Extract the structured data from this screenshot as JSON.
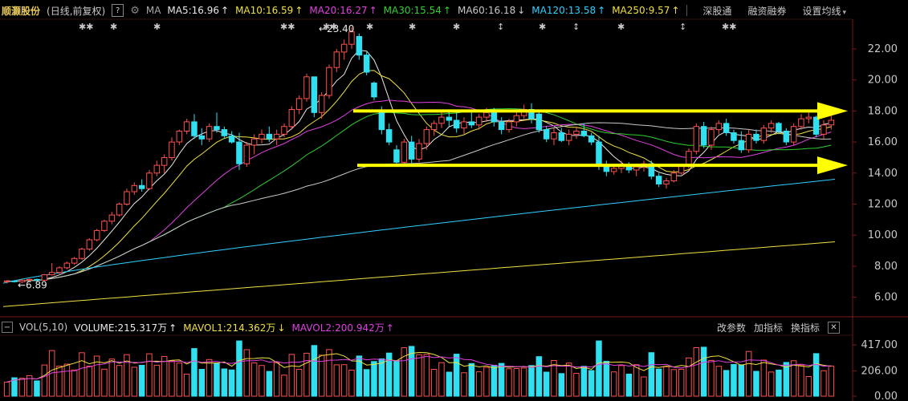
{
  "header": {
    "stock_name": "顺灏股份",
    "period_label": "(日线,前复权)",
    "help_button": "?",
    "ma_label": "MA",
    "ma": [
      {
        "label": "MA5:16.96",
        "trend": "↑",
        "color": "#e8e8e8"
      },
      {
        "label": "MA10:16.59",
        "trend": "↑",
        "color": "#f0e040"
      },
      {
        "label": "MA20:16.27",
        "trend": "↑",
        "color": "#e040e0"
      },
      {
        "label": "MA30:15.54",
        "trend": "↑",
        "color": "#30d030"
      },
      {
        "label": "MA60:16.18",
        "trend": "↓",
        "color": "#c8c8c8"
      },
      {
        "label": "MA120:13.58",
        "trend": "↑",
        "color": "#30d0ff"
      },
      {
        "label": "MA250:9.57",
        "trend": "↑",
        "color": "#f0e040"
      }
    ],
    "menu": {
      "shenzhen_connect": "深股通",
      "margin_trading": "融资融券",
      "settings_ma": "设置均线"
    }
  },
  "markers": {
    "symbols": [
      "✱✱",
      "✱",
      "✱",
      "✱✱",
      "✱✱",
      "✱",
      "✱",
      "✱",
      "↕",
      "✱",
      "↕",
      "✱",
      "↕",
      "✱✱"
    ]
  },
  "price_axis": {
    "ticks": [
      "22.00",
      "20.00",
      "18.00",
      "16.00",
      "14.00",
      "12.00",
      "10.00",
      "8.00",
      "6.00"
    ]
  },
  "annotations": {
    "high": "23.40",
    "low": "6.89"
  },
  "volume_panel": {
    "collapse_button": "−",
    "title": "VOL(5,10)",
    "volume": "VOLUME:215.317万",
    "volume_trend": "↑",
    "mavol1": "MAVOL1:214.362万",
    "mavol1_trend": "↓",
    "mavol2": "MAVOL2:200.942万",
    "mavol2_trend": "↑",
    "tools": {
      "edit_params": "改参数",
      "add_indicator": "加指标",
      "switch_indicator": "换指标",
      "close": "✕"
    },
    "axis_ticks": [
      "417.00",
      "206.00",
      "0.00"
    ]
  },
  "colors": {
    "up": "#ff5050",
    "down": "#30e0f0",
    "ma5": "#e8e8e8",
    "ma10": "#f0e040",
    "ma20": "#e040e0",
    "ma30": "#30d030",
    "ma60": "#c8c8c8",
    "ma120": "#30d0ff",
    "ma250": "#f0e040",
    "trendline": "#ffff00"
  },
  "chart_data": {
    "type": "candlestick",
    "ylim": [
      5.0,
      23.6
    ],
    "price_ticks": [
      22,
      20,
      18,
      16,
      14,
      12,
      10,
      8,
      6
    ],
    "annotated_high": 23.4,
    "annotated_low": 6.89,
    "horizontal_levels": [
      18.0,
      14.5
    ],
    "candles": [
      [
        7.0,
        7.1,
        6.9,
        7.05
      ],
      [
        7.05,
        7.1,
        6.95,
        7.0
      ],
      [
        7.0,
        7.15,
        6.9,
        7.1
      ],
      [
        7.1,
        7.2,
        7.0,
        7.15
      ],
      [
        7.15,
        7.2,
        7.05,
        7.1
      ],
      [
        7.1,
        7.5,
        7.05,
        7.45
      ],
      [
        7.45,
        8.2,
        7.4,
        7.6
      ],
      [
        7.6,
        8.0,
        7.5,
        7.9
      ],
      [
        7.9,
        8.3,
        7.8,
        8.2
      ],
      [
        8.2,
        8.6,
        8.1,
        8.5
      ],
      [
        8.5,
        9.2,
        8.4,
        9.1
      ],
      [
        9.1,
        9.8,
        9.0,
        9.7
      ],
      [
        9.7,
        10.4,
        9.6,
        10.3
      ],
      [
        10.3,
        11.0,
        10.2,
        10.9
      ],
      [
        10.9,
        11.5,
        10.7,
        11.3
      ],
      [
        11.3,
        12.1,
        11.2,
        12.0
      ],
      [
        12.0,
        13.0,
        11.9,
        12.8
      ],
      [
        12.8,
        13.4,
        12.6,
        13.2
      ],
      [
        13.2,
        13.6,
        12.8,
        13.0
      ],
      [
        13.0,
        14.2,
        12.9,
        14.0
      ],
      [
        14.0,
        14.8,
        13.8,
        14.5
      ],
      [
        14.5,
        15.2,
        14.0,
        15.0
      ],
      [
        15.0,
        16.3,
        14.8,
        16.0
      ],
      [
        16.0,
        16.8,
        15.8,
        16.7
      ],
      [
        16.7,
        17.5,
        16.5,
        17.3
      ],
      [
        17.3,
        17.8,
        16.2,
        16.4
      ],
      [
        16.4,
        16.9,
        15.8,
        16.2
      ],
      [
        16.2,
        17.2,
        16.0,
        17.0
      ],
      [
        17.0,
        17.9,
        16.6,
        16.8
      ],
      [
        16.8,
        17.0,
        16.2,
        16.4
      ],
      [
        16.4,
        16.7,
        15.9,
        16.0
      ],
      [
        16.0,
        16.6,
        14.2,
        14.6
      ],
      [
        14.6,
        16.0,
        14.4,
        15.8
      ],
      [
        15.8,
        16.5,
        15.2,
        16.2
      ],
      [
        16.2,
        16.8,
        15.9,
        16.5
      ],
      [
        16.5,
        17.0,
        16.0,
        16.2
      ],
      [
        16.2,
        16.8,
        15.8,
        16.5
      ],
      [
        16.5,
        17.2,
        16.3,
        17.0
      ],
      [
        17.0,
        18.3,
        16.8,
        18.1
      ],
      [
        18.1,
        19.0,
        17.8,
        18.8
      ],
      [
        18.8,
        20.4,
        18.6,
        20.2
      ],
      [
        20.2,
        19.9,
        17.6,
        17.9
      ],
      [
        17.9,
        19.2,
        17.5,
        19.0
      ],
      [
        19.0,
        21.0,
        18.8,
        20.8
      ],
      [
        20.8,
        22.0,
        20.5,
        21.8
      ],
      [
        21.8,
        22.6,
        21.3,
        22.3
      ],
      [
        22.3,
        23.4,
        22.0,
        23.1
      ],
      [
        22.8,
        23.0,
        21.3,
        21.6
      ],
      [
        21.6,
        21.8,
        20.3,
        20.5
      ],
      [
        19.8,
        19.9,
        18.7,
        18.9
      ],
      [
        18.0,
        18.3,
        16.5,
        16.8
      ],
      [
        16.8,
        17.2,
        15.8,
        16.0
      ],
      [
        15.5,
        15.8,
        14.5,
        14.7
      ],
      [
        14.7,
        16.2,
        14.5,
        16.0
      ],
      [
        16.0,
        16.4,
        14.6,
        14.9
      ],
      [
        14.9,
        16.2,
        14.7,
        15.9
      ],
      [
        15.9,
        17.0,
        15.5,
        16.8
      ],
      [
        16.8,
        17.4,
        16.4,
        17.2
      ],
      [
        17.2,
        18.0,
        16.9,
        17.6
      ],
      [
        17.6,
        18.0,
        17.0,
        17.4
      ],
      [
        17.4,
        18.0,
        16.6,
        16.9
      ],
      [
        16.9,
        17.6,
        16.5,
        17.3
      ],
      [
        17.3,
        17.9,
        16.9,
        17.1
      ],
      [
        17.1,
        17.8,
        16.8,
        17.6
      ],
      [
        17.6,
        18.2,
        17.3,
        17.9
      ],
      [
        17.9,
        18.2,
        17.0,
        17.3
      ],
      [
        17.3,
        17.6,
        16.5,
        16.8
      ],
      [
        16.8,
        17.5,
        16.6,
        17.3
      ],
      [
        17.3,
        18.0,
        17.0,
        17.7
      ],
      [
        17.7,
        18.4,
        17.5,
        18.1
      ],
      [
        18.1,
        18.5,
        17.2,
        17.5
      ],
      [
        17.8,
        17.9,
        16.6,
        16.8
      ],
      [
        16.8,
        17.0,
        16.0,
        16.2
      ],
      [
        16.2,
        16.9,
        15.8,
        16.6
      ],
      [
        16.6,
        16.9,
        16.0,
        16.1
      ],
      [
        16.1,
        16.8,
        15.8,
        16.5
      ],
      [
        16.5,
        17.0,
        16.2,
        16.7
      ],
      [
        16.7,
        17.2,
        16.3,
        16.4
      ],
      [
        16.4,
        16.6,
        15.8,
        16.0
      ],
      [
        16.0,
        16.4,
        14.2,
        14.5
      ],
      [
        14.5,
        14.8,
        13.8,
        14.1
      ],
      [
        14.1,
        14.6,
        13.9,
        14.3
      ],
      [
        14.3,
        14.8,
        14.0,
        14.5
      ],
      [
        14.5,
        14.7,
        14.0,
        14.2
      ],
      [
        14.2,
        14.6,
        13.8,
        14.4
      ],
      [
        14.4,
        14.8,
        14.1,
        14.6
      ],
      [
        14.6,
        14.8,
        13.6,
        13.8
      ],
      [
        13.8,
        14.0,
        13.1,
        13.3
      ],
      [
        13.3,
        13.7,
        13.0,
        13.5
      ],
      [
        13.5,
        14.2,
        13.4,
        14.0
      ],
      [
        14.0,
        14.6,
        13.9,
        14.5
      ],
      [
        14.5,
        15.6,
        14.3,
        15.4
      ],
      [
        15.4,
        17.2,
        15.2,
        17.0
      ],
      [
        17.0,
        17.3,
        15.6,
        15.8
      ],
      [
        15.8,
        17.0,
        15.5,
        16.8
      ],
      [
        16.8,
        17.4,
        16.5,
        17.2
      ],
      [
        17.2,
        17.5,
        16.4,
        16.6
      ],
      [
        16.6,
        16.8,
        15.9,
        16.1
      ],
      [
        16.1,
        16.7,
        15.3,
        15.5
      ],
      [
        15.5,
        16.8,
        15.3,
        16.5
      ],
      [
        16.5,
        16.8,
        15.9,
        16.1
      ],
      [
        16.1,
        17.1,
        15.9,
        16.9
      ],
      [
        16.9,
        17.4,
        16.6,
        17.2
      ],
      [
        17.2,
        17.3,
        16.5,
        16.7
      ],
      [
        16.7,
        16.9,
        15.8,
        16.0
      ],
      [
        16.0,
        17.2,
        15.8,
        17.0
      ],
      [
        17.0,
        17.8,
        16.8,
        17.5
      ],
      [
        17.5,
        17.9,
        17.2,
        17.6
      ],
      [
        17.6,
        17.7,
        16.3,
        16.5
      ],
      [
        16.5,
        17.4,
        16.2,
        17.1
      ],
      [
        17.1,
        17.7,
        16.8,
        17.4
      ]
    ],
    "volume": {
      "ylim": [
        0,
        470
      ],
      "ticks": [
        417,
        206,
        0
      ],
      "mavol1": 214.362,
      "mavol2": 200.942,
      "last": 215.317
    }
  }
}
